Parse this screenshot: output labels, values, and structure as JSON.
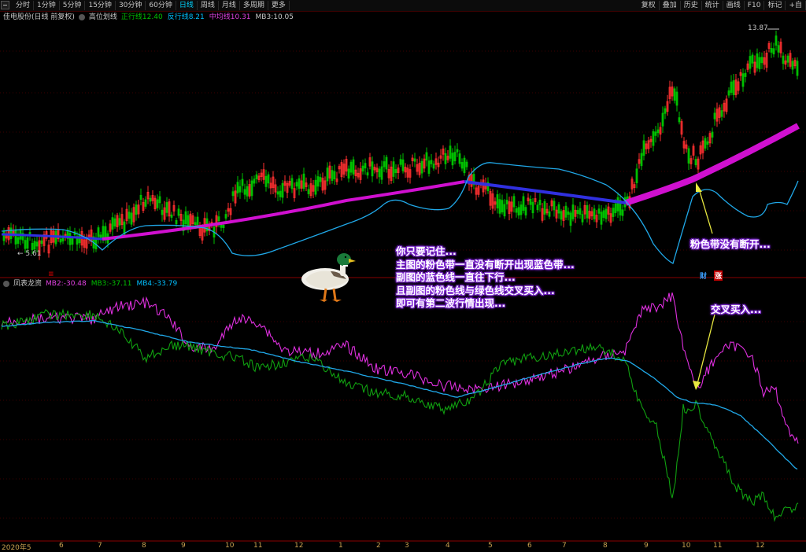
{
  "toolbar": {
    "left_tabs": [
      "分时",
      "1分钟",
      "5分钟",
      "15分钟",
      "30分钟",
      "60分钟",
      "日线",
      "周线",
      "月线",
      "多周期",
      "更多"
    ],
    "active_tab": "日线",
    "right_tabs": [
      "复权",
      "叠加",
      "历史",
      "统计",
      "画线",
      "F10",
      "标记",
      "+自"
    ]
  },
  "main_legend": {
    "stock": "佳电股份(日线 前复权)",
    "indicator": "高位划线",
    "items": [
      {
        "label": "正行线",
        "value": "12.40",
        "color": "#00c000"
      },
      {
        "label": "反行线",
        "value": "8.21",
        "color": "#00bfff"
      },
      {
        "label": "中均线",
        "value": "10.31",
        "color": "#e040e0"
      },
      {
        "label": "MB3:",
        "value": "10.05",
        "color": "#c8c8c8"
      }
    ]
  },
  "sub_legend": {
    "indicator": "凤表龙资",
    "items": [
      {
        "label": "MB2:",
        "value": "-30.48",
        "color": "#e040e0"
      },
      {
        "label": "MB3:",
        "value": "-37.11",
        "color": "#00c000"
      },
      {
        "label": "MB4:",
        "value": "-33.79",
        "color": "#00bfff"
      }
    ]
  },
  "price_labels": {
    "high": "13.87",
    "low": "5.61"
  },
  "annotations": {
    "main_note": [
      "你只要记住...",
      "主图的粉色带一直没有断开出现蓝色带...",
      "副图的蓝色线一直往下行...",
      "且副图的粉色线与绿色线交叉买入...",
      "即可有第二波行情出现..."
    ],
    "pink_band_note": "粉色带没有断开...",
    "cross_note": "交叉买入..."
  },
  "badges": {
    "cai": "财",
    "zhang": "涨",
    "marker": "≡"
  },
  "dates": [
    "2020年5",
    "6",
    "7",
    "8",
    "9",
    "10",
    "11",
    "12",
    "1",
    "2",
    "3",
    "4",
    "5",
    "6",
    "7",
    "8",
    "9",
    "10",
    "11",
    "12"
  ],
  "colors": {
    "up": "#ff3030",
    "down": "#00c000",
    "pink": "#d010d0",
    "blue_band": "#3030e0",
    "cyan": "#20a8e8",
    "magenta": "#e030e0",
    "green": "#10a010",
    "arrow": "#e8e840",
    "grid": "#3c0000"
  },
  "chart_data": {
    "type": "candlestick",
    "price_range": [
      5.61,
      13.87
    ],
    "upper_series": [
      {
        "name": "正行线",
        "last": 12.4
      },
      {
        "name": "反行线",
        "last": 8.21
      },
      {
        "name": "中均线",
        "last": 10.31
      },
      {
        "name": "MB3",
        "last": 10.05
      }
    ],
    "lower_series": [
      {
        "name": "MB2",
        "last": -30.48
      },
      {
        "name": "MB3",
        "last": -37.11
      },
      {
        "name": "MB4",
        "last": -33.79
      }
    ]
  }
}
